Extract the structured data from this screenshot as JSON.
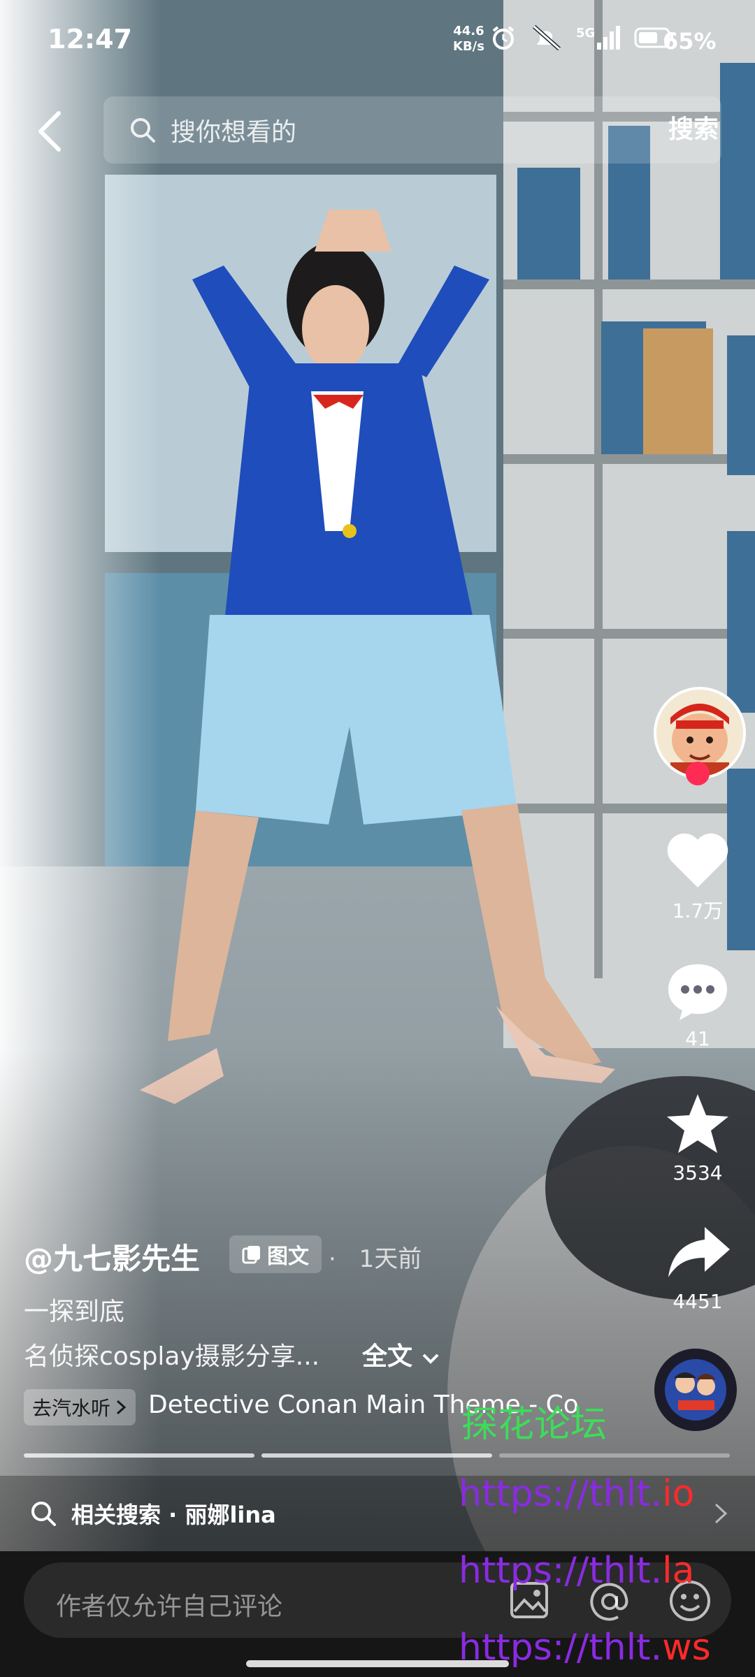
{
  "status_bar": {
    "time": "12:47",
    "net_speed_value": "44.6",
    "net_speed_unit": "KB/s",
    "signal_label": "5G",
    "battery": "65%"
  },
  "search": {
    "placeholder": "搜你想看的",
    "button": "搜索"
  },
  "rail": {
    "likes": "1.7万",
    "comments": "41",
    "favorites": "3534",
    "shares": "4451"
  },
  "post": {
    "author": "@九七影先生",
    "tag": "图文",
    "dot": "·",
    "time_ago": "1天前",
    "caption_line_1": "一探到底",
    "caption_line_2": "名侦探cosplay摄影分享...",
    "full_text": "全文"
  },
  "music": {
    "tag": "去汽水听",
    "title": "Detective Conan Main Theme - Co"
  },
  "related": {
    "label": "相关搜索 · 丽娜lina"
  },
  "comment": {
    "placeholder": "作者仅允许自己评论"
  },
  "watermark": {
    "line_1": "探花论坛",
    "line_2": "https://thlt.io",
    "line_3": "https://thlt.la",
    "line_4": "https://thlt.ws"
  },
  "colors": {
    "accent_red": "#fe2c55",
    "watermark_green": "#3ddc5a",
    "watermark_purple": "#8a2be2",
    "watermark_red": "#ff2a2a"
  }
}
